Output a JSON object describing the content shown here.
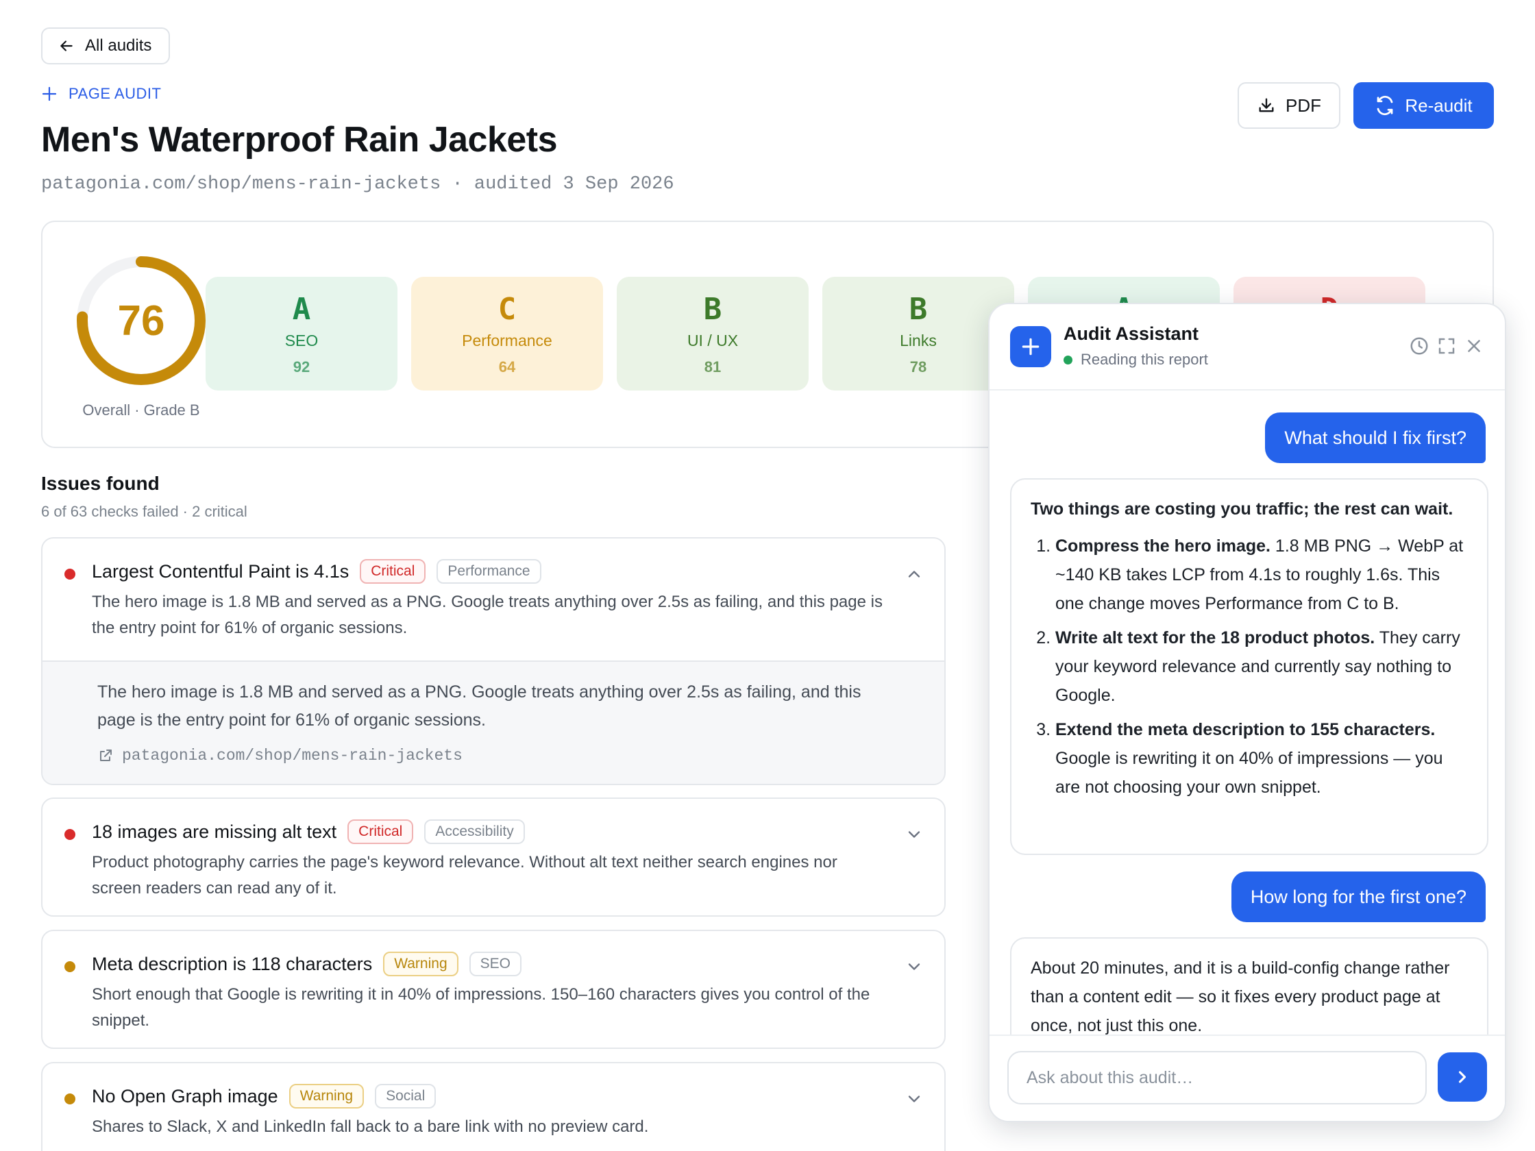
{
  "header": {
    "back_label": "All audits",
    "eyebrow": "PAGE AUDIT",
    "title": "Men's Waterproof Rain Jackets",
    "subline": "patagonia.com/shop/mens-rain-jackets · audited 3 Sep 2026",
    "pdf_label": "PDF",
    "reaudit_label": "Re-audit"
  },
  "overall": {
    "score": "76",
    "score_fraction": 0.76,
    "caption": "Overall · Grade B",
    "color": "#c58a0a"
  },
  "grades": [
    {
      "letter": "A",
      "label": "SEO",
      "score": "92",
      "bg": "#e6f5ec",
      "fg": "#1f8a4c"
    },
    {
      "letter": "C",
      "label": "Performance",
      "score": "64",
      "bg": "#fdf1d8",
      "fg": "#c58a0a"
    },
    {
      "letter": "B",
      "label": "UI / UX",
      "score": "81",
      "bg": "#eaf3e6",
      "fg": "#3d7a2a"
    },
    {
      "letter": "B",
      "label": "Links",
      "score": "78",
      "bg": "#eaf3e6",
      "fg": "#3d7a2a"
    },
    {
      "letter": "A",
      "label": "",
      "score": "",
      "bg": "#e6f5ec",
      "fg": "#1f8a4c"
    },
    {
      "letter": "D",
      "label": "",
      "score": "",
      "bg": "#fbe6e6",
      "fg": "#d02828"
    }
  ],
  "issues_section": {
    "title": "Issues found",
    "subtitle": "6 of 63 checks failed · 2 critical"
  },
  "issues": [
    {
      "title": "Largest Contentful Paint is 4.1s",
      "severity": "Critical",
      "category": "Performance",
      "dot_color": "#d92b2b",
      "description": "The hero image is 1.8 MB and served as a PNG. Google treats anything over 2.5s as failing, and this page is the entry point for 61% of organic sessions.",
      "detail": "The hero image is 1.8 MB and served as a PNG. Google treats anything over 2.5s as failing, and this page is the entry point for 61% of organic sessions.",
      "link": "patagonia.com/shop/mens-rain-jackets"
    },
    {
      "title": "18 images are missing alt text",
      "severity": "Critical",
      "category": "Accessibility",
      "dot_color": "#d92b2b",
      "description": "Product photography carries the page's keyword relevance. Without alt text neither search engines nor screen readers can read any of it."
    },
    {
      "title": "Meta description is 118 characters",
      "severity": "Warning",
      "category": "SEO",
      "dot_color": "#c58a0a",
      "description": "Short enough that Google is rewriting it in 40% of impressions. 150–160 characters gives you control of the snippet."
    },
    {
      "title": "No Open Graph image",
      "severity": "Warning",
      "category": "Social",
      "dot_color": "#c58a0a",
      "description": "Shares to Slack, X and LinkedIn fall back to a bare link with no preview card."
    }
  ],
  "assistant": {
    "title": "Audit Assistant",
    "status": "Reading this report",
    "msg1_user": "What should I fix first?",
    "msg2_intro": "Two things are costing you traffic; the rest can wait.",
    "msg2_items": [
      {
        "bold": "Compress the hero image.",
        "text": " 1.8 MB PNG → WebP at ~140 KB takes LCP from 4.1s to roughly 1.6s. This one change moves Performance from C to B."
      },
      {
        "bold": "Write alt text for the 18 product photos.",
        "text": " They carry your keyword relevance and currently say nothing to Google."
      },
      {
        "bold": "Extend the meta description to 155 characters.",
        "text": " Google is rewriting it on 40% of impressions — you are not choosing your own snippet."
      }
    ],
    "msg3_user": "How long for the first one?",
    "msg4_bot": "About 20 minutes, and it is a build-config change rather than a content edit — so it fixes every product page at once, not just this one.",
    "input_placeholder": "Ask about this audit…"
  },
  "colors": {
    "accent": "#2563eb",
    "critical": "#d92b2b",
    "warning": "#c58a0a",
    "online": "#22a35a"
  }
}
